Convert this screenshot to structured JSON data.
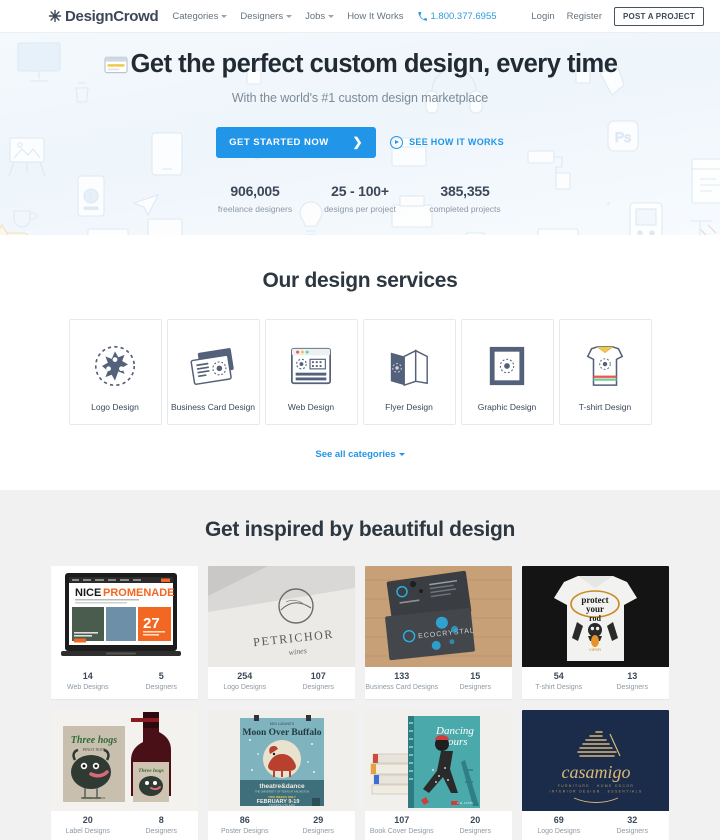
{
  "header": {
    "brand": "DesignCrowd",
    "brand_icon": "asterisk-logo-icon",
    "nav": [
      {
        "label": "Categories",
        "has_caret": true
      },
      {
        "label": "Designers",
        "has_caret": true
      },
      {
        "label": "Jobs",
        "has_caret": true
      },
      {
        "label": "How It Works",
        "has_caret": false
      }
    ],
    "phone": "1.800.377.6955",
    "phone_icon": "phone-icon",
    "login": "Login",
    "register": "Register",
    "post_project": "POST A PROJECT"
  },
  "hero": {
    "title": "Get the perfect custom design, every time",
    "subtitle": "With the world's #1 custom design marketplace",
    "cta_primary": "GET STARTED NOW",
    "cta_primary_icon": "chevron-right-icon",
    "cta_secondary": "SEE HOW IT WORKS",
    "cta_secondary_icon": "play-circle-icon",
    "stats": [
      {
        "value": "906,005",
        "label": "freelance designers"
      },
      {
        "value": "25 - 100+",
        "label": "designs per project"
      },
      {
        "value": "385,355",
        "label": "completed projects"
      }
    ],
    "accent_color": "#2196e8"
  },
  "services": {
    "title": "Our design services",
    "see_all": "See all categories",
    "items": [
      {
        "label": "Logo Design",
        "icon": "logo-burst-icon"
      },
      {
        "label": "Business Card Design",
        "icon": "business-card-icon"
      },
      {
        "label": "Web Design",
        "icon": "browser-window-icon"
      },
      {
        "label": "Flyer Design",
        "icon": "folded-flyer-icon"
      },
      {
        "label": "Graphic Design",
        "icon": "framed-art-icon"
      },
      {
        "label": "T-shirt Design",
        "icon": "tshirt-icon"
      }
    ]
  },
  "inspire": {
    "title": "Get inspired by beautiful design",
    "gallery": [
      {
        "image": "laptop-website-mockup",
        "count": "14",
        "count_label": "Web Designs",
        "designers": "5",
        "designers_label": "Designers"
      },
      {
        "image": "petrichor-wines-logo",
        "count": "254",
        "count_label": "Logo Designs",
        "designers": "107",
        "designers_label": "Designers"
      },
      {
        "image": "dark-business-cards",
        "count": "133",
        "count_label": "Business Card Designs",
        "designers": "15",
        "designers_label": "Designers"
      },
      {
        "image": "protect-your-rod-tshirt",
        "count": "54",
        "count_label": "T-shirt Designs",
        "designers": "13",
        "designers_label": "Designers"
      },
      {
        "image": "wine-bottle-label",
        "count": "20",
        "count_label": "Label Designs",
        "designers": "8",
        "designers_label": "Designers"
      },
      {
        "image": "moon-over-buffalo-poster",
        "count": "86",
        "count_label": "Poster Designs",
        "designers": "29",
        "designers_label": "Designers"
      },
      {
        "image": "dancing-hours-book-cover",
        "count": "107",
        "count_label": "Book Cover Designs",
        "designers": "20",
        "designers_label": "Designers"
      },
      {
        "image": "casamigo-gold-logo",
        "count": "69",
        "count_label": "Logo Designs",
        "designers": "32",
        "designers_label": "Designers"
      }
    ]
  }
}
